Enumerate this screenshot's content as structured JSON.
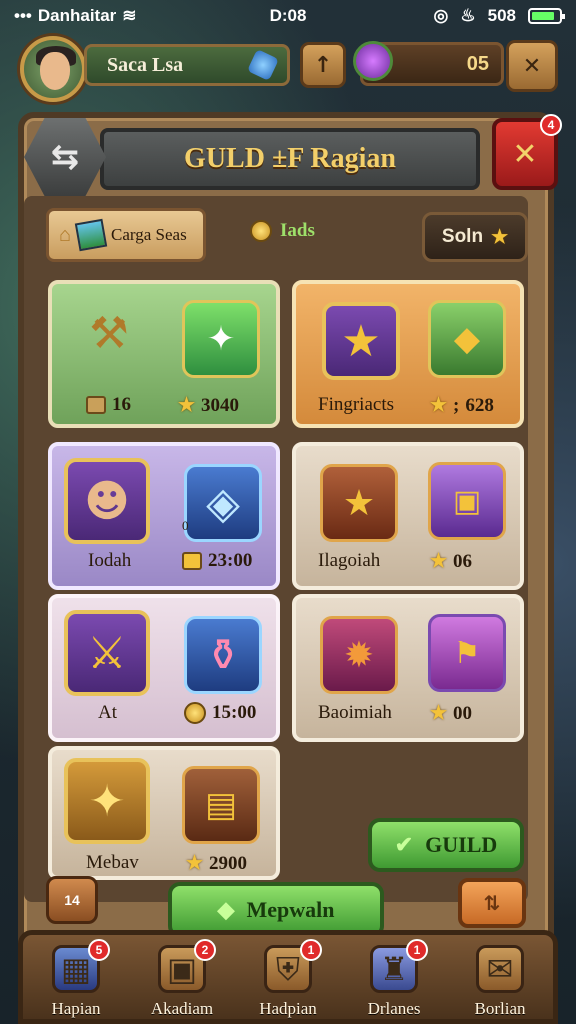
{
  "status": {
    "carrier": "Danhaitar",
    "time": "D:08",
    "battery_text": "508",
    "battery_level": 0.85
  },
  "topbar": {
    "player_name": "Saca Lsa",
    "currency_value": "05",
    "action1_icon": "arrow-icon",
    "close_icon": "x-icon"
  },
  "header": {
    "title": "GULD ±F Ragian",
    "back_icon": "arrows-icon",
    "close_badge": "4"
  },
  "filter": {
    "label": "Carga Seas",
    "level_label": "Iads"
  },
  "solnButton": {
    "label": "Soln"
  },
  "cards": [
    {
      "price": "16",
      "price2": "3040"
    },
    {
      "label": "Fingriacts",
      "price": "628"
    },
    {
      "label": "Iodah",
      "price": "23:00",
      "tag": "0"
    },
    {
      "label": "Ilagoiah",
      "price": "06"
    },
    {
      "label": "At",
      "price": "15:00"
    },
    {
      "label": "Baoimiah",
      "price": "00"
    },
    {
      "label": "Mebav",
      "price": "2900"
    }
  ],
  "buttons": {
    "guild": "GUILD",
    "main": "Mepwaln",
    "small_tag": "14"
  },
  "nav": [
    {
      "label": "Hapian",
      "badge": "5"
    },
    {
      "label": "Akadiam",
      "badge": "2"
    },
    {
      "label": "Hadpian",
      "badge": "1"
    },
    {
      "label": "Drlanes",
      "badge": "1"
    },
    {
      "label": "Borlian",
      "badge": ""
    }
  ]
}
